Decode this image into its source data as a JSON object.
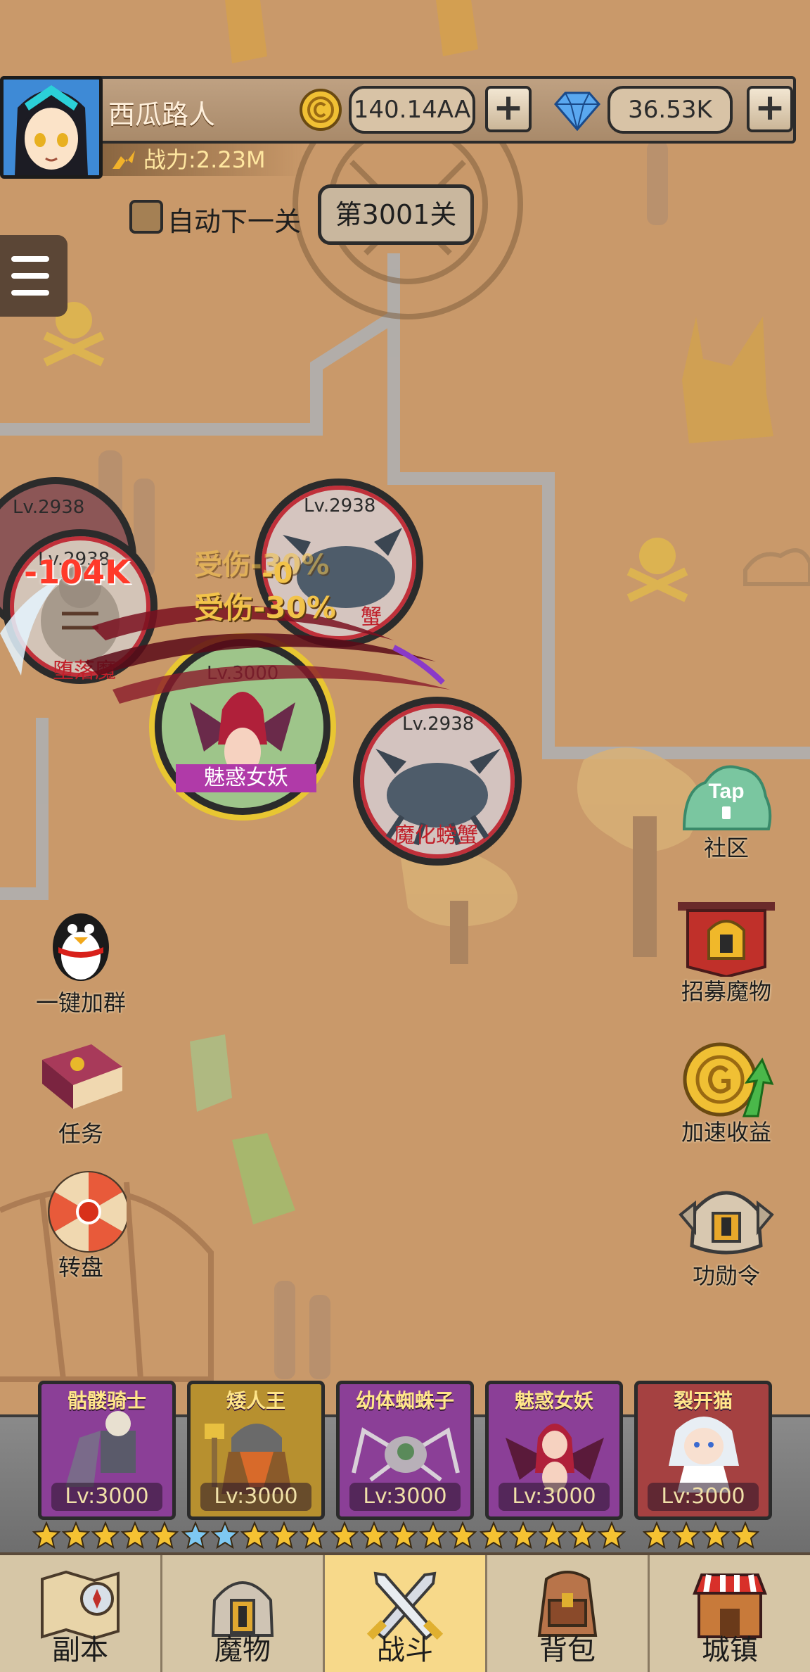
{
  "player": {
    "name": "西瓜路人",
    "power": "战力:2.23M"
  },
  "resources": {
    "gold": {
      "icon": "gold-coin-icon",
      "value": "140.14AA",
      "add_label": "+"
    },
    "diamond": {
      "icon": "diamond-icon",
      "value": "36.53K",
      "add_label": "+"
    }
  },
  "stage": {
    "auto_next_label": "自动下一关",
    "auto_next_checked": false,
    "current": "第3001关"
  },
  "battle": {
    "enemies": [
      {
        "level": "Lv.2938",
        "name": "堕落魔"
      },
      {
        "level": "Lv.2938",
        "name": "蟹"
      },
      {
        "level": "Lv.2938",
        "name": "魔化螃蟹"
      }
    ],
    "extra_level": "Lv.2938",
    "hero": {
      "level": "Lv.3000",
      "name": "魅惑女妖"
    },
    "floating_texts": [
      "-104K",
      "受伤-30%",
      "受伤-30%",
      "-0"
    ]
  },
  "left_buttons": [
    {
      "label": "一键加群",
      "icon": "penguin-icon"
    },
    {
      "label": "任务",
      "icon": "quest-book-icon"
    },
    {
      "label": "转盘",
      "icon": "wheel-icon"
    }
  ],
  "right_buttons": [
    {
      "label": "社区",
      "icon": "tap-community-icon",
      "badge": "Tap"
    },
    {
      "label": "招募魔物",
      "icon": "recruit-banner-icon"
    },
    {
      "label": "加速收益",
      "icon": "speed-coin-icon"
    },
    {
      "label": "功勋令",
      "icon": "helmet-icon"
    }
  ],
  "team": [
    {
      "name": "骷髅骑士",
      "level": "Lv:3000",
      "stars": 5,
      "star_color": "#f5c232"
    },
    {
      "name": "矮人王",
      "level": "Lv:3000",
      "stars": 5,
      "star_color": "mixed"
    },
    {
      "name": "幼体蜘蛛子",
      "level": "Lv:3000",
      "stars": 5,
      "star_color": "#f5c232"
    },
    {
      "name": "魅惑女妖",
      "level": "Lv:3000",
      "stars": 5,
      "star_color": "#f5c232"
    },
    {
      "name": "裂开猫",
      "level": "Lv:3000",
      "stars": 4,
      "star_color": "#f5c232"
    }
  ],
  "nav": [
    {
      "label": "副本",
      "icon": "map-icon",
      "active": false
    },
    {
      "label": "魔物",
      "icon": "monster-helmet-icon",
      "active": false
    },
    {
      "label": "战斗",
      "icon": "crossed-swords-icon",
      "active": true
    },
    {
      "label": "背包",
      "icon": "backpack-icon",
      "active": false
    },
    {
      "label": "城镇",
      "icon": "town-shop-icon",
      "active": false
    }
  ]
}
